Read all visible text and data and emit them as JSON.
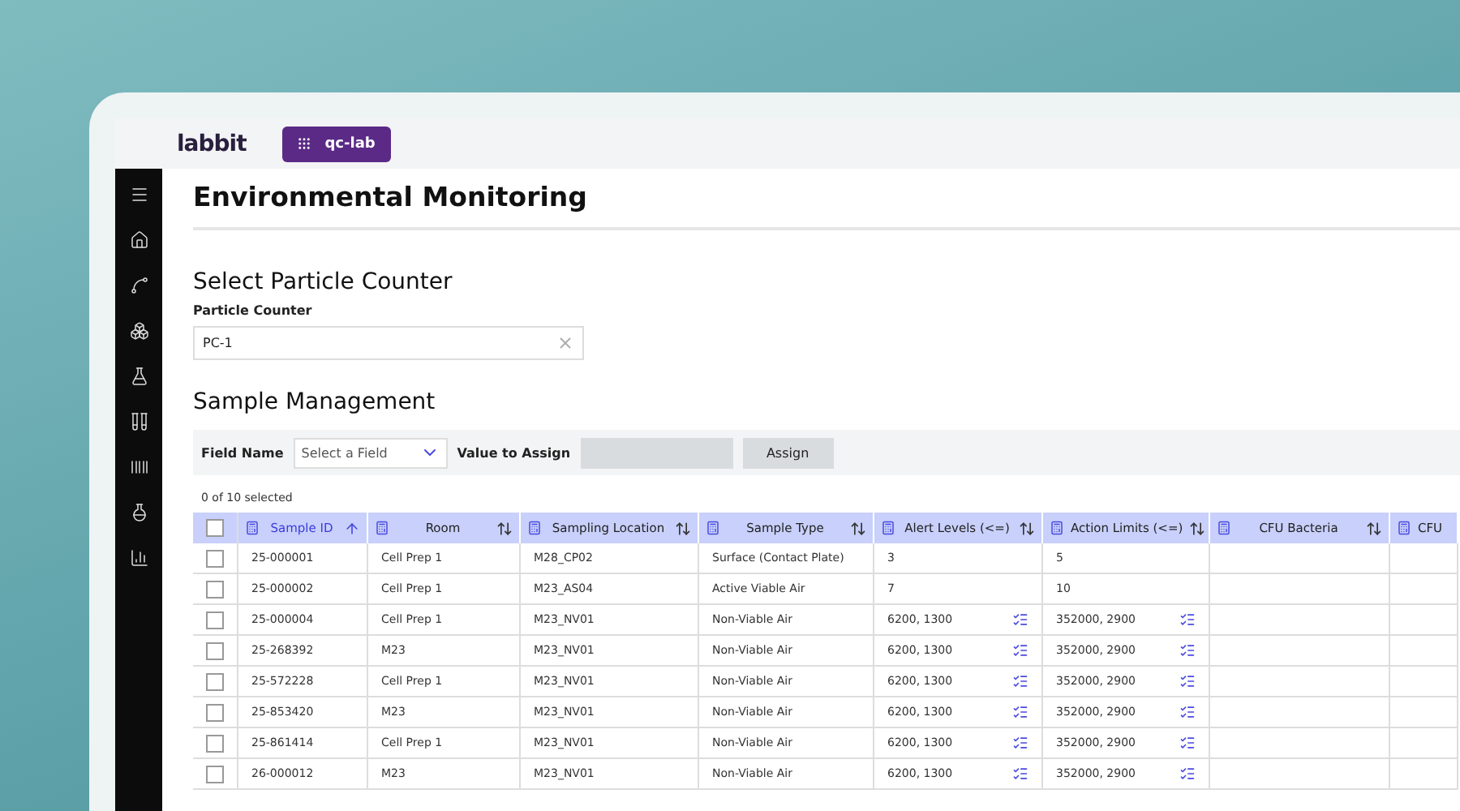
{
  "app": {
    "logo": "labbit",
    "workspace": "qc-lab"
  },
  "page": {
    "title": "Environmental Monitoring"
  },
  "particle_counter": {
    "heading": "Select Particle Counter",
    "label": "Particle Counter",
    "value": "PC-1"
  },
  "sample_management": {
    "heading": "Sample Management",
    "field_name_label": "Field Name",
    "field_select_placeholder": "Select a Field",
    "value_label": "Value to Assign",
    "assign_button": "Assign"
  },
  "table": {
    "selection_count": "0 of 10 selected",
    "all_checked": false,
    "columns": [
      {
        "label": "Sample ID",
        "sorted": true
      },
      {
        "label": "Room",
        "sorted": false
      },
      {
        "label": "Sampling Location",
        "sorted": false
      },
      {
        "label": "Sample Type",
        "sorted": false
      },
      {
        "label": "Alert Levels (<=)",
        "sorted": false
      },
      {
        "label": "Action Limits (<=)",
        "sorted": false
      },
      {
        "label": "CFU Bacteria",
        "sorted": false
      },
      {
        "label": "CFU",
        "sorted": false
      }
    ],
    "rows": [
      {
        "checked": false,
        "kind": "plain",
        "cells": [
          "25-000001",
          "Cell Prep 1",
          "M28_CP02",
          "Surface (Contact Plate)",
          "3",
          "5"
        ]
      },
      {
        "checked": false,
        "kind": "plain",
        "cells": [
          "25-000002",
          "Cell Prep 1",
          "M23_AS04",
          "Active Viable Air",
          "7",
          "10"
        ]
      },
      {
        "checked": false,
        "kind": "detail",
        "cells": [
          "25-000004",
          "Cell Prep 1",
          "M23_NV01",
          "Non-Viable Air",
          "6200, 1300",
          "352000, 2900"
        ]
      },
      {
        "checked": false,
        "kind": "detail",
        "cells": [
          "25-268392",
          "M23",
          "M23_NV01",
          "Non-Viable Air",
          "6200, 1300",
          "352000, 2900"
        ]
      },
      {
        "checked": false,
        "kind": "detail",
        "cells": [
          "25-572228",
          "Cell Prep 1",
          "M23_NV01",
          "Non-Viable Air",
          "6200, 1300",
          "352000, 2900"
        ]
      },
      {
        "checked": false,
        "kind": "detail",
        "cells": [
          "25-853420",
          "M23",
          "M23_NV01",
          "Non-Viable Air",
          "6200, 1300",
          "352000, 2900"
        ]
      },
      {
        "checked": false,
        "kind": "detail",
        "cells": [
          "25-861414",
          "Cell Prep 1",
          "M23_NV01",
          "Non-Viable Air",
          "6200, 1300",
          "352000, 2900"
        ]
      },
      {
        "checked": false,
        "kind": "detail",
        "cells": [
          "26-000012",
          "M23",
          "M23_NV01",
          "Non-Viable Air",
          "6200, 1300",
          "352000, 2900"
        ]
      }
    ]
  }
}
